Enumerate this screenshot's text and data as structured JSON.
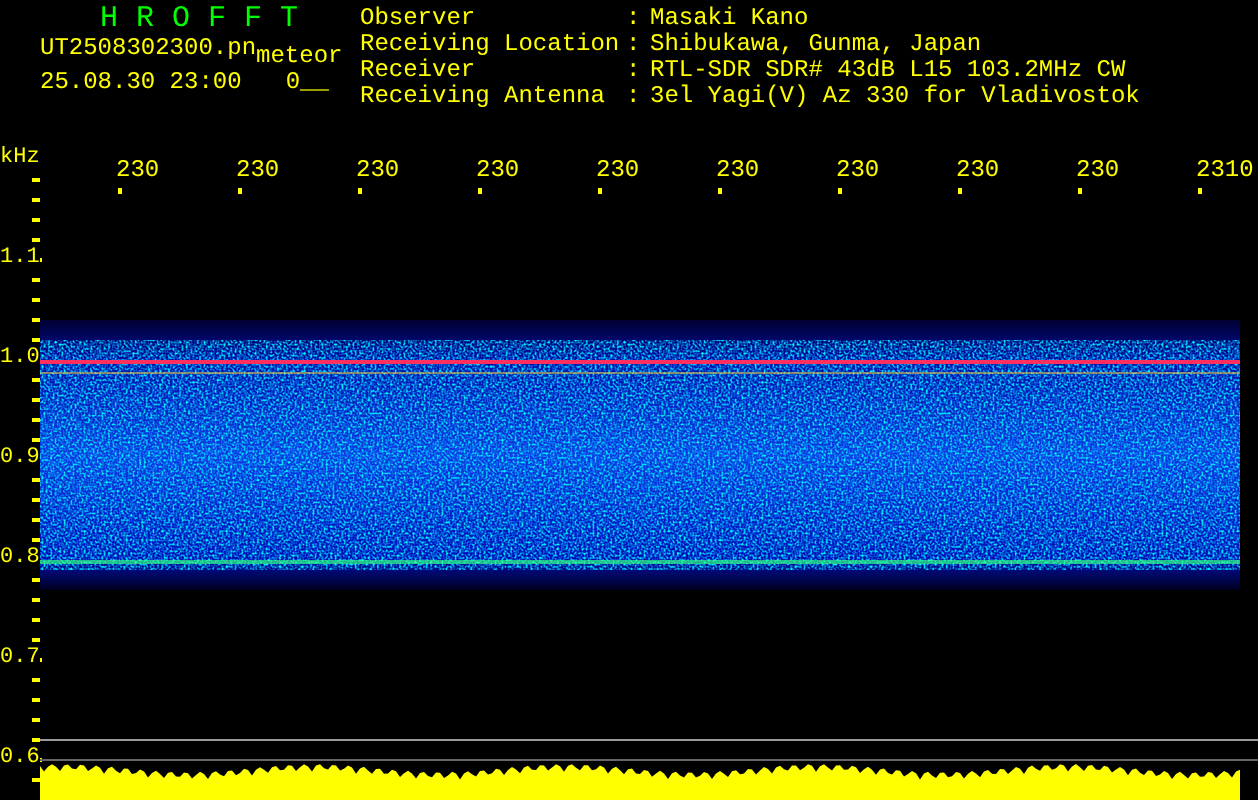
{
  "title": "H R O F F T",
  "file": {
    "name": "UT2508302300.pn",
    "type": "meteor",
    "time": "25.08.30 23:00",
    "count": "0__"
  },
  "info": [
    {
      "label": "Observer",
      "separator": ":",
      "value": "Masaki Kano"
    },
    {
      "label": "Receiving Location",
      "separator": ":",
      "value": "Shibukawa, Gunma, Japan"
    },
    {
      "label": "Receiver",
      "separator": ":",
      "value": "RTL-SDR SDR# 43dB L15 103.2MHz CW"
    },
    {
      "label": "Receiving Antenna",
      "separator": ":",
      "value": "3el Yagi(V) Az 330 for Vladivostok"
    }
  ],
  "frequency_axis": {
    "unit": "kHz",
    "labels": [
      "1.1",
      "1.0",
      "0.9",
      "0.8",
      "0.7",
      "0.6"
    ]
  },
  "time_axis": {
    "labels": [
      "230",
      "230",
      "230",
      "230",
      "230",
      "230",
      "230",
      "230",
      "230",
      "2310"
    ]
  }
}
